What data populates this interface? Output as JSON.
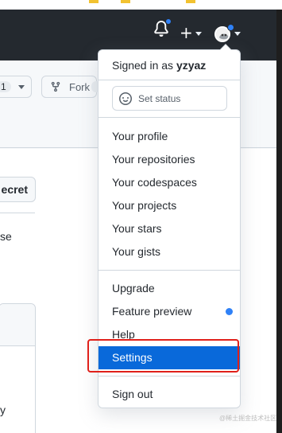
{
  "header": {
    "notifications_icon": "bell-icon",
    "create_icon": "plus-icon",
    "avatar_icon": "avatar-icon"
  },
  "repo_bar": {
    "left_count": "1",
    "fork_label": "Fork"
  },
  "main": {
    "secret_button_fragment": "ecret",
    "text_fragment_1": "se",
    "text_fragment_2": "y"
  },
  "dropdown": {
    "signed_in_prefix": "Signed in as",
    "username": "yzyaz",
    "set_status_label": "Set status",
    "section1": [
      {
        "label": "Your profile"
      },
      {
        "label": "Your repositories"
      },
      {
        "label": "Your codespaces"
      },
      {
        "label": "Your projects"
      },
      {
        "label": "Your stars"
      },
      {
        "label": "Your gists"
      }
    ],
    "section2": [
      {
        "label": "Upgrade"
      },
      {
        "label": "Feature preview"
      },
      {
        "label": "Help"
      },
      {
        "label": "Settings"
      }
    ],
    "sign_out_label": "Sign out",
    "active_item": "Settings"
  },
  "colors": {
    "header_bg": "#24292f",
    "accent": "#0969da",
    "notification_dot": "#2f81f7",
    "highlight_border": "#e0201a"
  },
  "watermark": "@稀土掘金技术社区"
}
